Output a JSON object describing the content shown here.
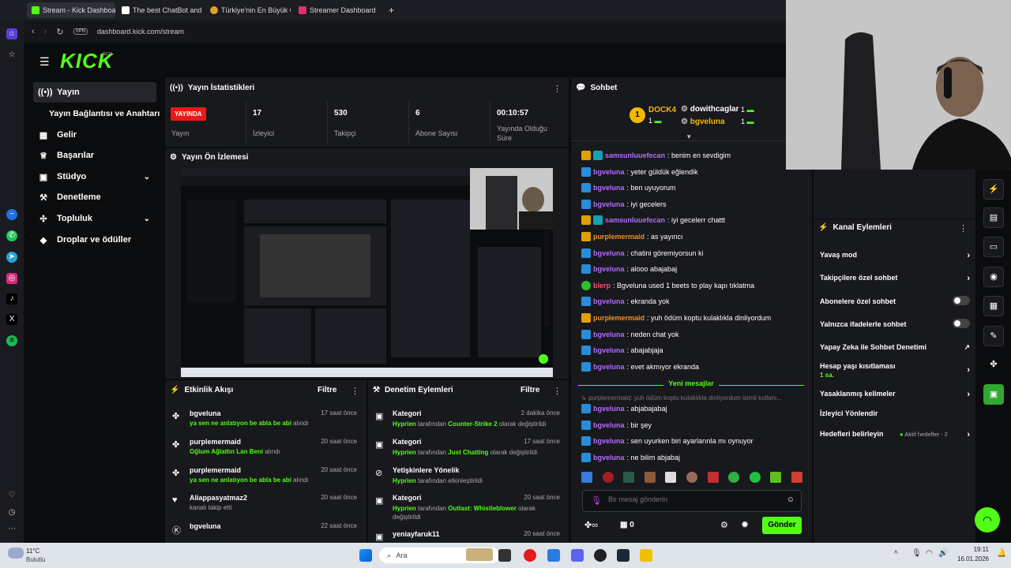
{
  "browser": {
    "tabs": [
      {
        "title": "Stream - Kick Dashboard",
        "active": true
      },
      {
        "title": "The best ChatBot and Wid"
      },
      {
        "title": "Türkiye'nin En Büyük Oyun"
      },
      {
        "title": "Streamer Dashboard"
      }
    ],
    "url": "dashboard.kick.com/stream",
    "vpn": "VPN"
  },
  "kick": {
    "logo": "KICK",
    "beta": "BETA"
  },
  "sidebar": {
    "items": [
      {
        "label": "Yayın",
        "icon": "broadcast-icon"
      },
      {
        "label": "Yayın Bağlantısı ve Anahtarı"
      },
      {
        "label": "Gelir",
        "icon": "revenue-icon"
      },
      {
        "label": "Başarılar",
        "icon": "trophy-icon"
      },
      {
        "label": "Stüdyo",
        "icon": "studio-icon"
      },
      {
        "label": "Denetleme",
        "icon": "hammer-icon"
      },
      {
        "label": "Topluluk",
        "icon": "community-icon"
      },
      {
        "label": "Droplar ve ödüller",
        "icon": "drops-icon"
      }
    ]
  },
  "stats": {
    "title": "Yayın İstatistikleri",
    "live": "YAYINDA",
    "cells": [
      {
        "label": "Yayın",
        "value": ""
      },
      {
        "label": "İzleyici",
        "value": "17"
      },
      {
        "label": "Takipçi",
        "value": "530"
      },
      {
        "label": "Abone Sayısı",
        "value": "6"
      },
      {
        "label": "Yayında Olduğu Süre",
        "value": "00:10:57"
      }
    ]
  },
  "preview": {
    "title": "Yayın Ön İzlemesi"
  },
  "activity": {
    "title": "Etkinlik Akışı",
    "filter": "Filtre",
    "items": [
      {
        "user": "bgveluna",
        "time": "17 saat önce",
        "highlight": "ya sen ne anlatıyon be abla be abi",
        "suffix": " alındı"
      },
      {
        "user": "purplemermaid",
        "time": "20 saat önce",
        "highlight": "Oğlum Ağlattın Lan Beni",
        "suffix": " alındı"
      },
      {
        "user": "purplemermaid",
        "time": "20 saat önce",
        "highlight": "ya sen ne anlatıyon be abla be abi",
        "suffix": " alındı"
      },
      {
        "user": "Aliappasyatmaz2",
        "time": "20 saat önce",
        "highlight": "",
        "suffix": "kanalı takip etti"
      },
      {
        "user": "bgveluna",
        "time": "22 saat önce",
        "highlight": "",
        "suffix": ""
      }
    ]
  },
  "moderation": {
    "title": "Denetim Eylemleri",
    "filter": "Filtre",
    "items": [
      {
        "title": "Kategori",
        "time": "2 dakika önce",
        "user": "Hyprien",
        "mid": " tarafından ",
        "target": "Counter-Strike 2",
        "end": " olarak değiştirildi"
      },
      {
        "title": "Kategori",
        "time": "17 saat önce",
        "user": "Hyprien",
        "mid": " tarafından ",
        "target": "Just Chatting",
        "end": " olarak değiştirildi"
      },
      {
        "title": "Yetişkinlere Yönelik",
        "time": "",
        "user": "Hyprien",
        "mid": " tarafından etkinleştirildi",
        "target": "",
        "end": ""
      },
      {
        "title": "Kategori",
        "time": "20 saat önce",
        "user": "Hyprien",
        "mid": " tarafından ",
        "target": "Outlast: Whistleblower",
        "end": " olarak değiştirildi"
      },
      {
        "title": "yeniayfaruk11",
        "time": "20 saat önce",
        "user": "",
        "mid": "",
        "target": "",
        "end": ""
      }
    ]
  },
  "chat": {
    "title": "Sohbet",
    "leaders": [
      {
        "name": "DOCK4",
        "rank": "1",
        "count": "1"
      },
      {
        "name": "dowithcaglar",
        "count": "1"
      },
      {
        "name": "bgveluna",
        "count": "1"
      }
    ],
    "messages": [
      {
        "user": "samsunluuefecan",
        "text": ": benim en sevdigim",
        "color": "purple",
        "badge": "gold"
      },
      {
        "user": "bgveluna",
        "text": ": yeter güldük eğlendik",
        "color": "purple",
        "badge": "blue"
      },
      {
        "user": "bgveluna",
        "text": ": ben uyuyorum",
        "color": "purple",
        "badge": "blue"
      },
      {
        "user": "bgveluna",
        "text": ": iyi gecelers",
        "color": "purple",
        "badge": "blue"
      },
      {
        "user": "samsunluuefecan",
        "text": ": iyi gecelerr chattt",
        "color": "purple",
        "badge": "gold"
      },
      {
        "user": "purplemermaid",
        "text": ": as yayıncı",
        "color": "orange",
        "badge": "gold"
      },
      {
        "user": "bgveluna",
        "text": ": chatini göremiyorsun ki",
        "color": "purple",
        "badge": "blue"
      },
      {
        "user": "bgveluna",
        "text": ": alooo abajabaj",
        "color": "purple",
        "badge": "blue"
      },
      {
        "user": "blerp",
        "text": ": Bgveluna used 1 beets to play kapı tıklatma",
        "color": "pink",
        "badge": "green"
      },
      {
        "user": "bgveluna",
        "text": ": ekranda yok",
        "color": "purple",
        "badge": "blue"
      },
      {
        "user": "purplemermaid",
        "text": ": yuh ödüm koptu kulaklıkla dinliyordum",
        "color": "orange",
        "badge": "gold"
      },
      {
        "user": "bgveluna",
        "text": ": neden chat yok",
        "color": "purple",
        "badge": "blue"
      },
      {
        "user": "bgveluna",
        "text": ": abajabjaja",
        "color": "purple",
        "badge": "blue"
      },
      {
        "user": "bgveluna",
        "text": ": evet akmıyor ekranda",
        "color": "purple",
        "badge": "blue"
      }
    ],
    "new_messages": "Yeni mesajlar",
    "reply_preview": "purplemermaid: yuh ödüm koptu kulaklıkla dinliyordum isimli kullanı...",
    "new": [
      {
        "user": "bgveluna",
        "text": ": abjabajabaj"
      },
      {
        "user": "bgveluna",
        "text": ": bir şey"
      },
      {
        "user": "bgveluna",
        "text": ": sen uyurken biri ayarlarınla mı oynuyor"
      },
      {
        "user": "bgveluna",
        "text": ": ne bilim abjabaj"
      }
    ],
    "placeholder": "Bir mesaj gönderin",
    "infinity": "∞",
    "count": "0",
    "send": "Gönder"
  },
  "kanal": {
    "title": "Kanal Eylemleri",
    "items": [
      {
        "label": "Yavaş mod",
        "kind": "chevron"
      },
      {
        "label": "Takipçilere özel sohbet",
        "kind": "chevron"
      },
      {
        "label": "Abonelere özel sohbet",
        "kind": "toggle"
      },
      {
        "label": "Yalnızca ifadelerle sohbet",
        "kind": "toggle"
      },
      {
        "label": "Yapay Zeka ile Sohbet Denetimi",
        "kind": "external"
      },
      {
        "label": "Hesap yaşı kısıtlaması",
        "sub": "1 sa.",
        "kind": "chevron"
      },
      {
        "label": "Yasaklanmış kelimeler",
        "kind": "chevron"
      },
      {
        "label": "İzleyici Yönlendir",
        "kind": "none"
      },
      {
        "label": "Hedefleri belirleyin",
        "extra": "Aktif hedefler - 2",
        "kind": "chevron"
      }
    ]
  },
  "taskbar": {
    "weather_temp": "11°C",
    "weather_desc": "Bulutlu",
    "search": "Ara",
    "time": "19:11",
    "date": "16.01.2026"
  }
}
